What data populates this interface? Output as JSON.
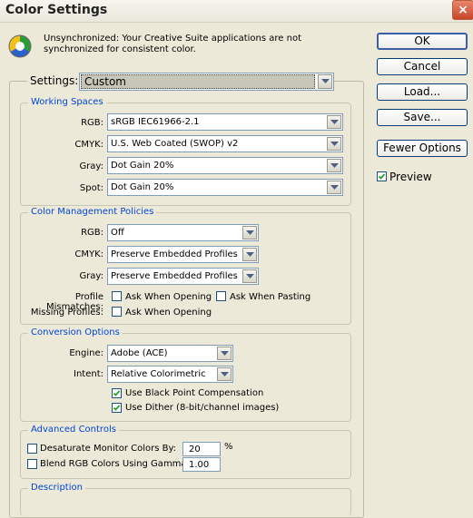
{
  "window": {
    "title": "Color Settings",
    "close_symbol": "×"
  },
  "message": "Unsynchronized: Your Creative Suite applications are not synchronized for consistent color.",
  "settings": {
    "label": "Settings:",
    "value": "Custom"
  },
  "working_spaces": {
    "title": "Working Spaces",
    "rgb_label": "RGB:",
    "rgb_value": "sRGB IEC61966-2.1",
    "cmyk_label": "CMYK:",
    "cmyk_value": "U.S. Web Coated (SWOP) v2",
    "gray_label": "Gray:",
    "gray_value": "Dot Gain 20%",
    "spot_label": "Spot:",
    "spot_value": "Dot Gain 20%"
  },
  "policies": {
    "title": "Color Management Policies",
    "rgb_label": "RGB:",
    "rgb_value": "Off",
    "cmyk_label": "CMYK:",
    "cmyk_value": "Preserve Embedded Profiles",
    "gray_label": "Gray:",
    "gray_value": "Preserve Embedded Profiles",
    "mismatch_label": "Profile Mismatches:",
    "ask_opening": "Ask When Opening",
    "ask_pasting": "Ask When Pasting",
    "missing_label": "Missing Profiles:",
    "missing_ask_opening": "Ask When Opening",
    "mismatch_ask_opening_checked": false,
    "mismatch_ask_pasting_checked": false,
    "missing_ask_opening_checked": false
  },
  "conversion": {
    "title": "Conversion Options",
    "engine_label": "Engine:",
    "engine_value": "Adobe (ACE)",
    "intent_label": "Intent:",
    "intent_value": "Relative Colorimetric",
    "black_point_label": "Use Black Point Compensation",
    "black_point_checked": true,
    "dither_label": "Use Dither (8-bit/channel images)",
    "dither_checked": true
  },
  "advanced": {
    "title": "Advanced Controls",
    "desaturate_label": "Desaturate Monitor Colors By:",
    "desaturate_checked": false,
    "desaturate_value": "20",
    "desaturate_unit": "%",
    "blend_label": "Blend RGB Colors Using Gamma:",
    "blend_checked": false,
    "blend_value": "1.00"
  },
  "description": {
    "title": "Description"
  },
  "buttons": {
    "ok": "OK",
    "cancel": "Cancel",
    "load": "Load...",
    "save": "Save...",
    "fewer_options": "Fewer Options"
  },
  "preview": {
    "label": "Preview",
    "checked": true
  },
  "colors": {
    "group_title": "#0046d5",
    "window_bg": "#ece9d8",
    "check": "#21a121"
  },
  "icons": {
    "status": "color-sync-icon",
    "dropdown": "chevron-down-icon",
    "checkmark": "checkmark-icon"
  }
}
